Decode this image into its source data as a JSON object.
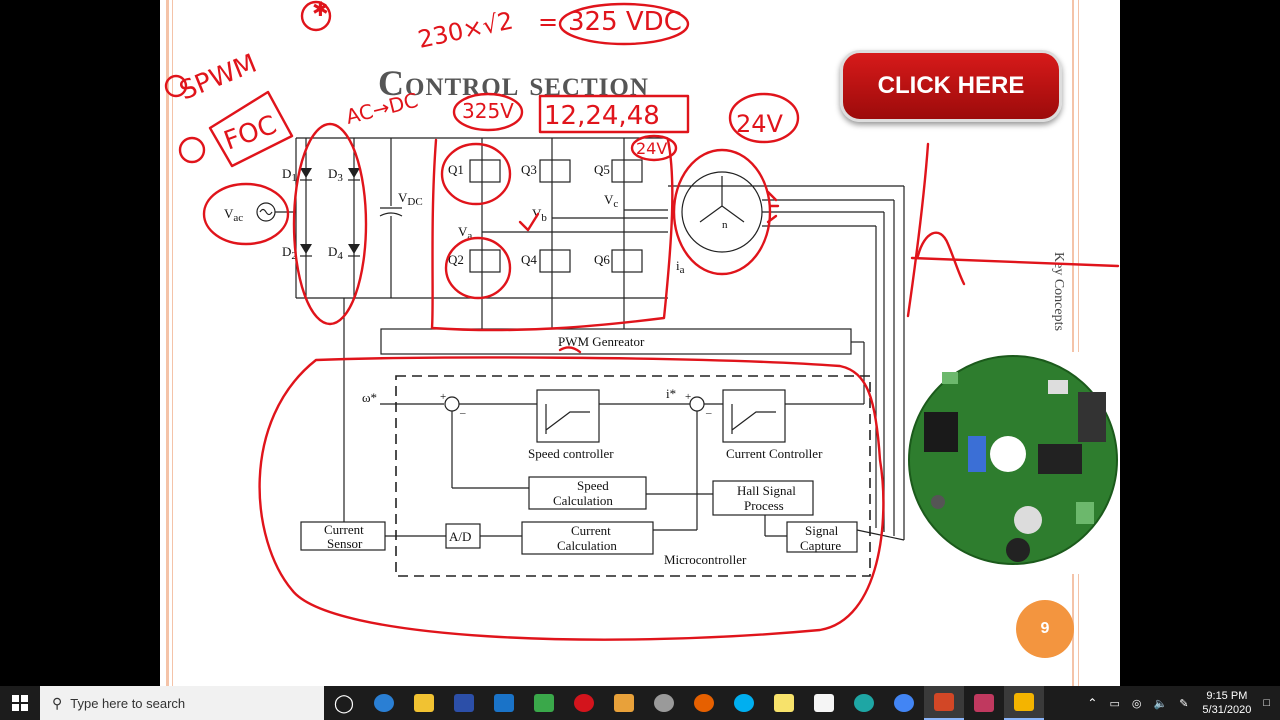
{
  "slide": {
    "title": "Control section",
    "click_button": "CLICK HERE",
    "side_note": "Key Concepts",
    "page_number": "9"
  },
  "diagram": {
    "labels": {
      "vac": "V",
      "vac_sub": "ac",
      "d1": "D",
      "d2": "D",
      "d3": "D",
      "d4": "D",
      "d1_sub": "1",
      "d2_sub": "2",
      "d3_sub": "3",
      "d4_sub": "4",
      "vdc": "V",
      "vdc_sub": "DC",
      "q1": "Q1",
      "q2": "Q2",
      "q3": "Q3",
      "q4": "Q4",
      "q5": "Q5",
      "q6": "Q6",
      "va": "V",
      "va_sub": "a",
      "vb": "V",
      "vb_sub": "b",
      "vc": "V",
      "vc_sub": "c",
      "ia": "i",
      "ia_sub": "a",
      "motor_n": "n",
      "pwm": "PWM Genreator",
      "omega": "ω*",
      "i_ref": "i*",
      "plus1": "+",
      "minus1": "–",
      "plus2": "+",
      "minus2": "–",
      "speed_controller": "Speed controller",
      "current_controller": "Current Controller",
      "speed_calc_1": "Speed",
      "speed_calc_2": "Calculation",
      "hall_1": "Hall Signal",
      "hall_2": "Process",
      "current_sensor_1": "Current",
      "current_sensor_2": "Sensor",
      "ad": "A/D",
      "current_calc_1": "Current",
      "current_calc_2": "Calculation",
      "signal_capture_1": "Signal",
      "signal_capture_2": "Capture",
      "microcontroller": "Microcontroller"
    },
    "annotations": {
      "eq_left": "230×√2",
      "eq_eq": "=",
      "eq_right": "325 VDC",
      "spwm": "SPWM",
      "foc": "FOC",
      "acdc": "AC→DC",
      "v325": "325V",
      "v12_24_48": "12,24,48",
      "v24": "24V",
      "v24_small": "24V",
      "star": "✱"
    },
    "colors": {
      "ink": "#e0141b",
      "button": "#c41212",
      "page_badge": "#f3953f"
    }
  },
  "taskbar": {
    "search_placeholder": "Type here to search",
    "icons": [
      "task-view-icon",
      "edge-icon",
      "file-explorer-icon",
      "app-e-icon",
      "mail-icon",
      "app-green-icon",
      "opera-icon",
      "app-outlook-icon",
      "app-pinwheel-icon",
      "firefox-icon",
      "skype-icon",
      "sticky-notes-icon",
      "blank-doc-icon",
      "edge-new-icon",
      "chrome-icon",
      "powerpoint-icon",
      "app-media-icon",
      "video-editor-icon"
    ],
    "time": "9:15 PM",
    "date": "5/31/2020"
  }
}
